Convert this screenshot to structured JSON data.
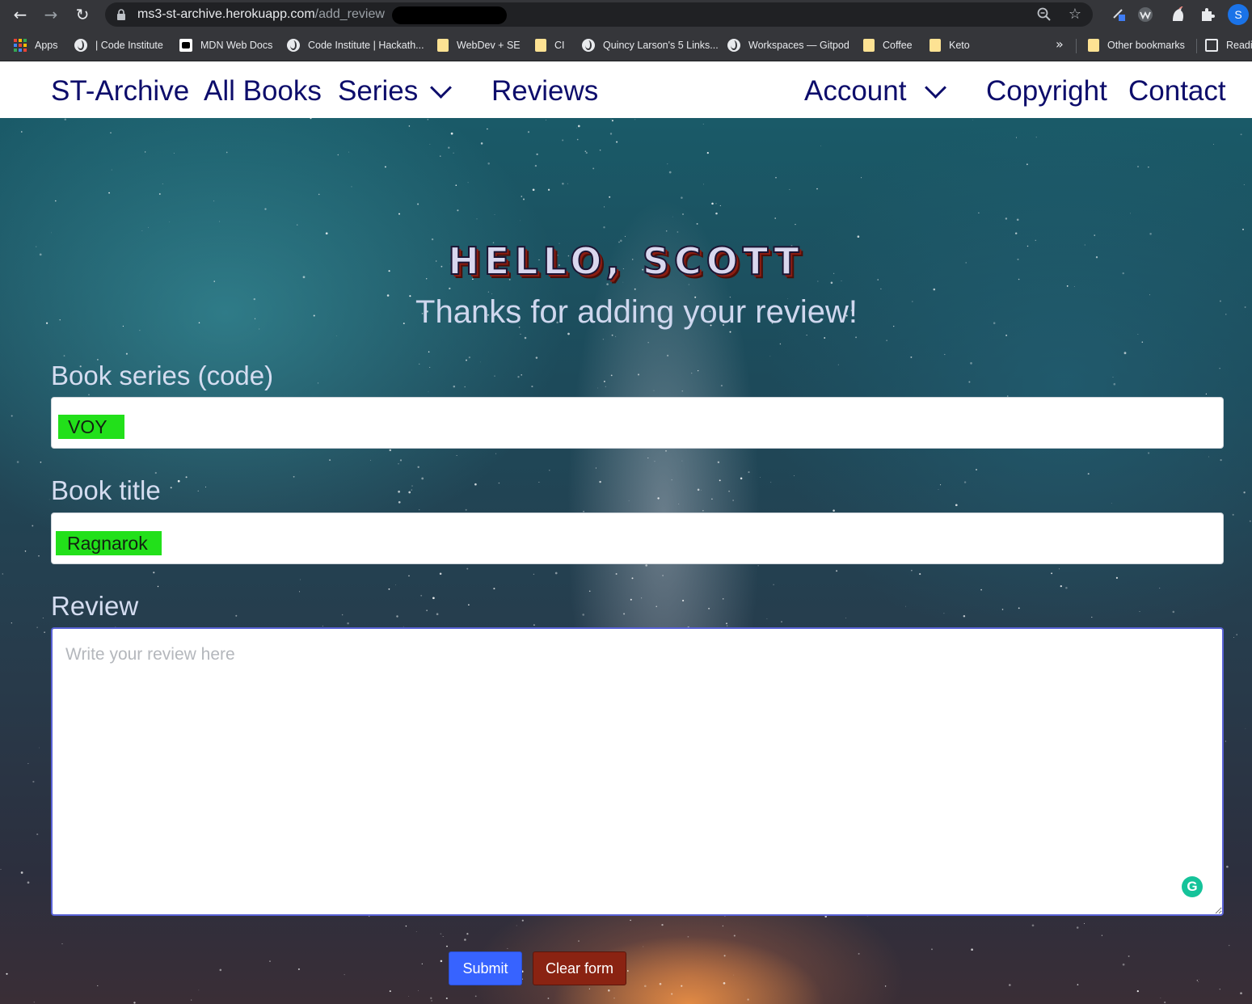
{
  "browser": {
    "url_host": "ms3-st-archive.herokuapp.com",
    "url_path": "/add_review",
    "profile_initial": "S",
    "bookmarks": [
      {
        "label": "Apps",
        "icon": "apps-grid-icon"
      },
      {
        "label": "| Code Institute",
        "icon": "globe-icon"
      },
      {
        "label": "MDN Web Docs",
        "icon": "mdn-icon"
      },
      {
        "label": "Code Institute | Hackath...",
        "icon": "globe-icon"
      },
      {
        "label": "WebDev + SE",
        "icon": "folder-icon"
      },
      {
        "label": "CI",
        "icon": "folder-icon"
      },
      {
        "label": "Quincy Larson's 5 Links...",
        "icon": "globe-icon"
      },
      {
        "label": "Workspaces — Gitpod",
        "icon": "globe-icon"
      },
      {
        "label": "Coffee",
        "icon": "folder-icon"
      },
      {
        "label": "Keto",
        "icon": "folder-icon"
      }
    ],
    "more_bookmarks": "»",
    "other_bookmarks": "Other bookmarks",
    "reading_list": "Readi"
  },
  "nav": {
    "brand": "ST-Archive",
    "all_books": "All Books",
    "series": "Series",
    "reviews": "Reviews",
    "account": "Account",
    "copyright": "Copyright",
    "contact": "Contact"
  },
  "page": {
    "greeting": "HELLO, SCOTT",
    "subtitle": "Thanks for adding your review!"
  },
  "form": {
    "series_label": "Book series (code)",
    "series_value": "VOY",
    "title_label": "Book title",
    "title_value": "Ragnarok",
    "review_label": "Review",
    "review_placeholder": "Write your review here",
    "review_value": "",
    "submit_label": "Submit",
    "clear_label": "Clear form"
  },
  "colors": {
    "nav_text": "#0d0d6b",
    "autofill_highlight": "#22e01a",
    "submit_button": "#3763ff",
    "clear_button": "#8a2312"
  }
}
